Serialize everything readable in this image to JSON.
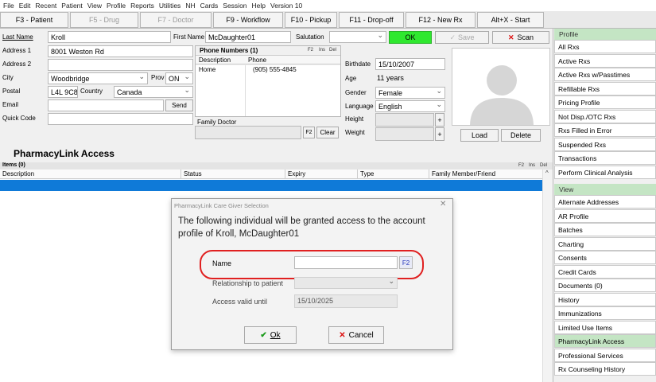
{
  "menu": [
    "File",
    "Edit",
    "Recent",
    "Patient",
    "View",
    "Profile",
    "Reports",
    "Utilities",
    "NH",
    "Cards",
    "Session",
    "Help",
    "Version 10"
  ],
  "fn_tabs": [
    {
      "label": "F3 - Patient",
      "disabled": false
    },
    {
      "label": "F5 - Drug",
      "disabled": true
    },
    {
      "label": "F7 - Doctor",
      "disabled": true
    },
    {
      "label": "F9 - Workflow",
      "disabled": false
    },
    {
      "label": "F10 - Pickup",
      "disabled": false
    },
    {
      "label": "F11 - Drop-off",
      "disabled": false
    },
    {
      "label": "F12 - New Rx",
      "disabled": false
    },
    {
      "label": "Alt+X - Start",
      "disabled": false
    }
  ],
  "form": {
    "last_name_label": "Last Name",
    "last_name": "Kroll",
    "first_name_label": "First Name",
    "first_name": "McDaughter01",
    "salutation_label": "Salutation",
    "salutation": "",
    "ok": "OK",
    "save": "Save",
    "scan": "Scan",
    "address1_label": "Address 1",
    "address1": "8001 Weston Rd",
    "address2_label": "Address 2",
    "address2": "",
    "city_label": "City",
    "city": "Woodbridge",
    "prov_label": "Prov",
    "prov": "ON",
    "postal_label": "Postal",
    "postal": "L4L 9C8",
    "country_label": "Country",
    "country": "Canada",
    "email_label": "Email",
    "email": "",
    "send": "Send",
    "quick_code_label": "Quick Code",
    "quick_code": "",
    "phone_title": "Phone Numbers (1)",
    "phone_f2": "F2",
    "phone_ins": "Ins",
    "phone_del": "Del",
    "phone_col_desc": "Description",
    "phone_col_phone": "Phone",
    "phone_desc": "Home",
    "phone_num": "(905) 555-4845",
    "family_doctor_label": "Family Doctor",
    "f2": "F2",
    "clear": "Clear",
    "birthdate_label": "Birthdate",
    "birthdate": "15/10/2007",
    "age_label": "Age",
    "age": "11 years",
    "gender_label": "Gender",
    "gender": "Female",
    "language_label": "Language",
    "language": "English",
    "height_label": "Height",
    "weight_label": "Weight",
    "plus": "+",
    "load": "Load",
    "delete": "Delete"
  },
  "access": {
    "title": "PharmacyLink Access",
    "items_label": "Items (0)",
    "f2": "F2",
    "ins": "Ins",
    "del": "Del",
    "columns": [
      "Description",
      "Status",
      "Expiry",
      "Type",
      "Family Member/Friend"
    ]
  },
  "dialog": {
    "title": "PharmacyLink Care Giver Selection",
    "close": "✕",
    "message": "The following individual will be granted access to the account profile of Kroll, McDaughter01",
    "name_label": "Name",
    "name_value": "",
    "name_f2": "F2",
    "relationship_label": "Relationship to patient",
    "relationship": "",
    "access_until_label": "Access valid until",
    "access_until": "15/10/2025",
    "ok": "Ok",
    "cancel": "Cancel"
  },
  "right_panel": {
    "profile_header": "Profile",
    "profile_items": [
      "All Rxs",
      "Active Rxs",
      "Active Rxs w/Passtimes",
      "Refillable Rxs",
      "Pricing Profile",
      "Not Disp./OTC Rxs",
      "Rxs Filled in Error",
      "Suspended Rxs",
      "Transactions",
      "Perform Clinical Analysis"
    ],
    "view_header": "View",
    "view_items": [
      "Alternate Addresses",
      "AR Profile",
      "Batches",
      "Charting",
      "Consents",
      "Credit Cards",
      "Documents (0)",
      "History",
      "Immunizations",
      "Limited Use Items",
      "PharmacyLink Access",
      "Professional Services",
      "Rx Counseling History"
    ],
    "active": "PharmacyLink Access",
    "colors": {
      "active_bg": "#c4e5c4",
      "header_bg": "#c4e5c4"
    }
  }
}
